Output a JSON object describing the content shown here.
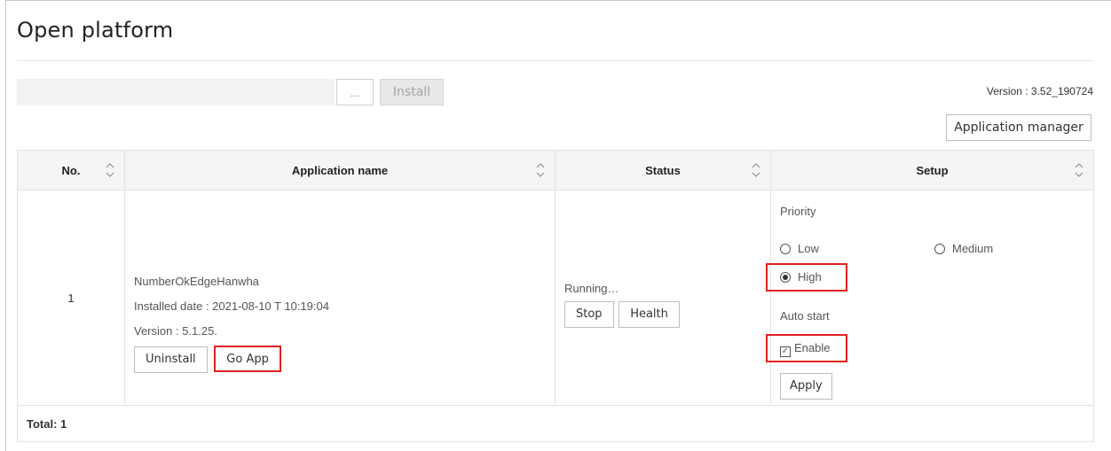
{
  "page": {
    "title": "Open platform"
  },
  "upload": {
    "browse_label": "...",
    "install_label": "Install"
  },
  "version": {
    "label": "Version : 3.52_190724"
  },
  "app_manager": {
    "label": "Application manager"
  },
  "table": {
    "headers": [
      "No.",
      "Application name",
      "Status",
      "Setup"
    ],
    "rows": [
      {
        "no": "1",
        "app_name": "NumberOkEdgeHanwha",
        "installed_date": "Installed date : 2021-08-10 T 10:19:04",
        "version": "Version : 5.1.25.",
        "uninstall_label": "Uninstall",
        "go_app_label": "Go App",
        "status": "Running…",
        "stop_label": "Stop",
        "health_label": "Health",
        "setup": {
          "priority_label": "Priority",
          "priority_options": [
            "Low",
            "Medium",
            "High"
          ],
          "priority_selected": "High",
          "auto_start_label": "Auto start",
          "enable_label": "Enable",
          "enable_checked": true,
          "apply_label": "Apply"
        }
      }
    ],
    "footer": "Total: 1"
  },
  "colors": {
    "highlight": "#e02020",
    "header_bg": "#f5f5f5"
  }
}
